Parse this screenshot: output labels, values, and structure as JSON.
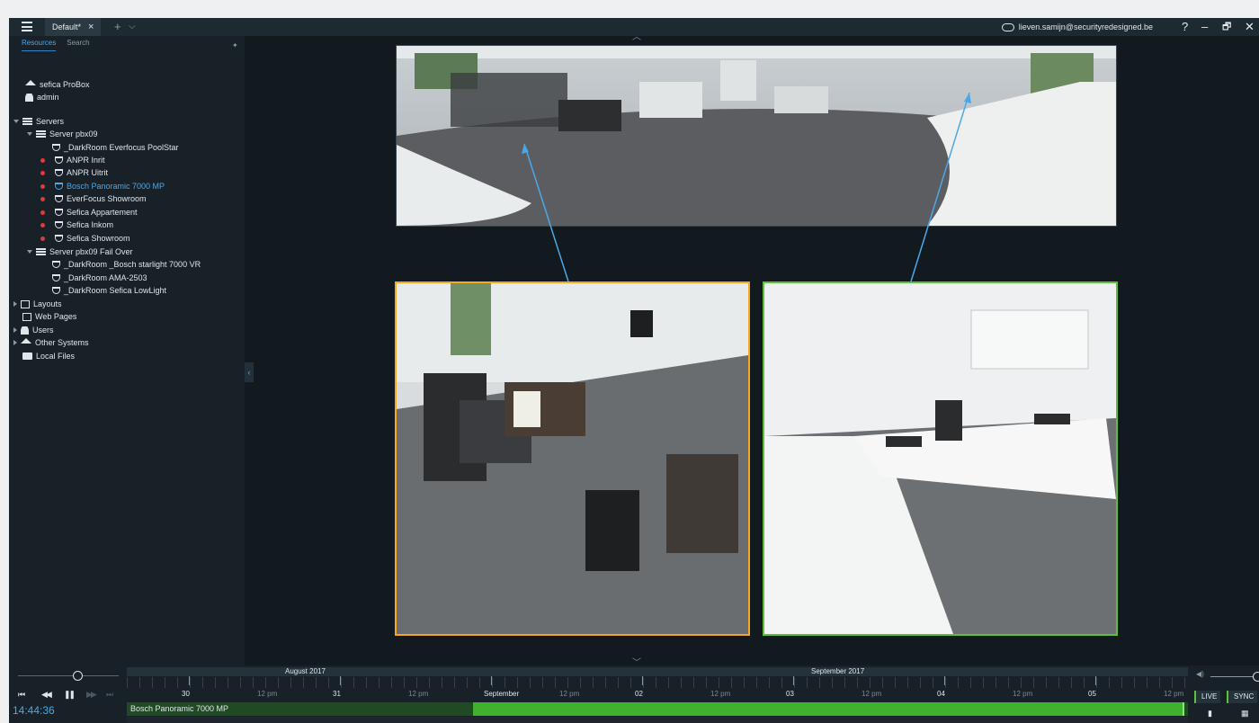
{
  "titlebar": {
    "tab_label": "Default*",
    "tab_close": "×",
    "add_tab": "+",
    "tab_menu": "⌵",
    "account": "lieven.samijn@securityredesigned.be",
    "help": "?",
    "minimize": "–",
    "restore": "🗗",
    "close": "✕"
  },
  "sidebar": {
    "tab_resources": "Resources",
    "tab_search": "Search",
    "pin": "✦",
    "system_name": "sefica ProBox",
    "user": "admin",
    "servers_label": "Servers",
    "server1": {
      "label": "Server pbx09",
      "cameras": [
        {
          "label": "_DarkRoom Everfocus PoolStar",
          "recording": false
        },
        {
          "label": "ANPR Inrit",
          "recording": true
        },
        {
          "label": "ANPR Uitrit",
          "recording": true
        },
        {
          "label": "Bosch Panoramic 7000 MP",
          "recording": true,
          "selected": true
        },
        {
          "label": "EverFocus Showroom",
          "recording": true
        },
        {
          "label": "Sefica Appartement",
          "recording": true
        },
        {
          "label": "Sefica Inkom",
          "recording": true
        },
        {
          "label": "Sefica Showroom",
          "recording": true
        }
      ]
    },
    "server2": {
      "label": "Server pbx09 Fail Over",
      "cameras": [
        {
          "label": "_DarkRoom _Bosch starlight 7000 VR"
        },
        {
          "label": "_DarkRoom AMA-2503"
        },
        {
          "label": "_DarkRoom Sefica LowLight"
        }
      ]
    },
    "layouts": "Layouts",
    "web_pages": "Web Pages",
    "users": "Users",
    "other_systems": "Other Systems",
    "local_files": "Local Files",
    "collapse": "‹"
  },
  "viewer": {
    "chevron_up": "︿",
    "chevron_down": "﹀"
  },
  "timeline": {
    "clock": "14:44:36",
    "months": [
      "August 2017",
      "September 2017"
    ],
    "ticks": [
      {
        "label": "30",
        "major": true
      },
      {
        "label": "12 pm",
        "major": false
      },
      {
        "label": "31",
        "major": true
      },
      {
        "label": "12 pm",
        "major": false
      },
      {
        "label": "September",
        "major": true
      },
      {
        "label": "12 pm",
        "major": false
      },
      {
        "label": "02",
        "major": true
      },
      {
        "label": "12 pm",
        "major": false
      },
      {
        "label": "03",
        "major": true
      },
      {
        "label": "12 pm",
        "major": false
      },
      {
        "label": "04",
        "major": true
      },
      {
        "label": "12 pm",
        "major": false
      },
      {
        "label": "05",
        "major": true
      },
      {
        "label": "12 pm",
        "major": false
      }
    ],
    "camera_name": "Bosch Panoramic 7000 MP",
    "live": "LIVE",
    "sync": "SYNC",
    "volume_icon": "◀)",
    "controls": {
      "prev": "⏮",
      "rewind": "◀◀",
      "pause": "❚❚",
      "forward": "▶▶",
      "next": "⏭"
    },
    "bookmark_icon": "▮",
    "calendar_icon": "▦"
  },
  "colors": {
    "selected_text": "#4aa8e8",
    "recording_dot": "#e53935",
    "tile_a_border": "#f4a825",
    "tile_b_border": "#5cc23a",
    "recorded": "#3fb12f"
  }
}
